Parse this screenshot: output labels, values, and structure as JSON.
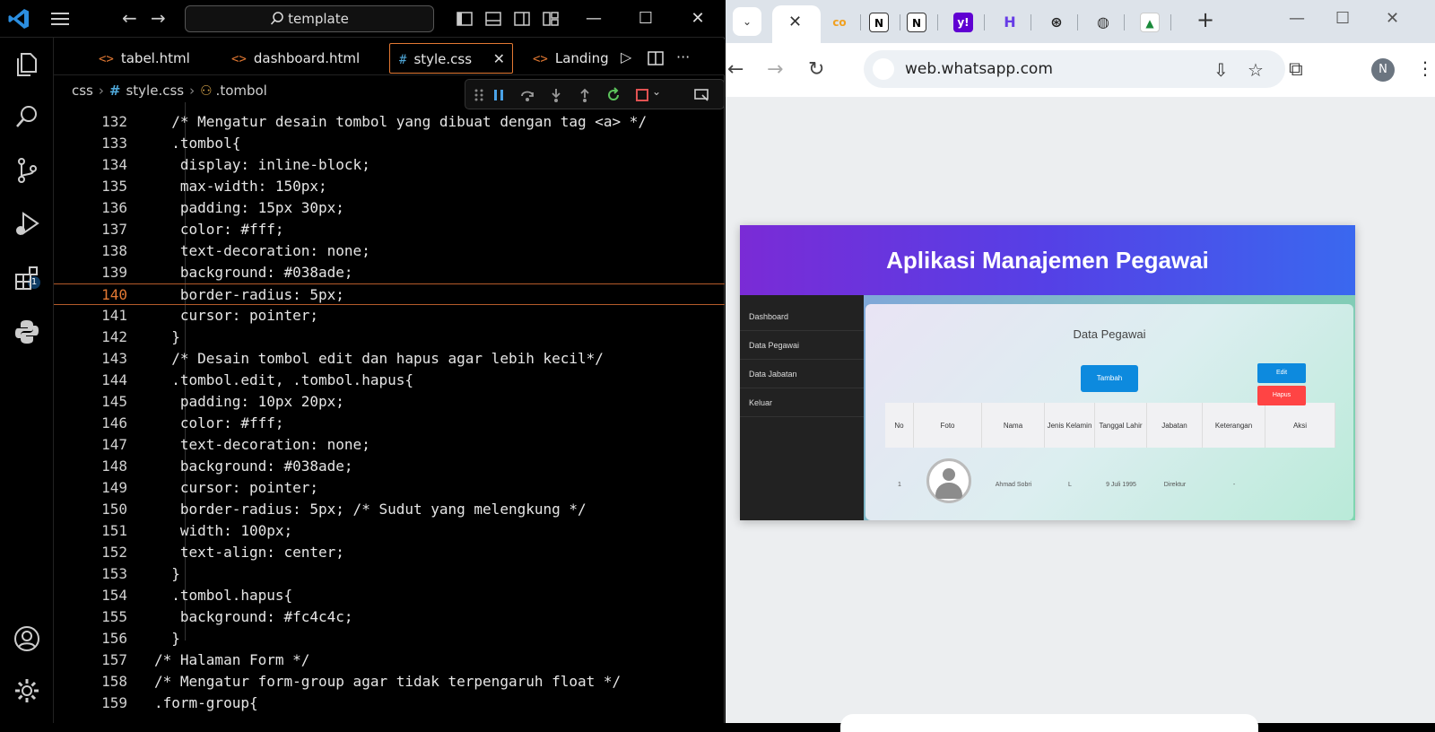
{
  "vscode": {
    "search": "template",
    "tabs": [
      {
        "label": "tabel.html",
        "icon": "<>"
      },
      {
        "label": "dashboard.html",
        "icon": "<>"
      },
      {
        "label": "style.css",
        "icon": "#"
      },
      {
        "label": "LandingP",
        "icon": "<>"
      }
    ],
    "breadcrumb": {
      "folder": "css",
      "file": "style.css",
      "symbol": ".tombol"
    },
    "debug_badge": "1",
    "current_line": "140",
    "lines": [
      {
        "n": "132",
        "code": "  /* Mengatur desain tombol yang dibuat dengan tag <a> */"
      },
      {
        "n": "133",
        "code": "  .tombol{"
      },
      {
        "n": "134",
        "code": "   display: inline-block;"
      },
      {
        "n": "135",
        "code": "   max-width: 150px;"
      },
      {
        "n": "136",
        "code": "   padding: 15px 30px;"
      },
      {
        "n": "137",
        "code": "   color: #fff;"
      },
      {
        "n": "138",
        "code": "   text-decoration: none;"
      },
      {
        "n": "139",
        "code": "   background: #038ade;"
      },
      {
        "n": "140",
        "code": "   border-radius: 5px;"
      },
      {
        "n": "141",
        "code": "   cursor: pointer;"
      },
      {
        "n": "142",
        "code": "  }"
      },
      {
        "n": "143",
        "code": "  /* Desain tombol edit dan hapus agar lebih kecil*/"
      },
      {
        "n": "144",
        "code": "  .tombol.edit, .tombol.hapus{"
      },
      {
        "n": "145",
        "code": "   padding: 10px 20px;"
      },
      {
        "n": "146",
        "code": "   color: #fff;"
      },
      {
        "n": "147",
        "code": "   text-decoration: none;"
      },
      {
        "n": "148",
        "code": "   background: #038ade;"
      },
      {
        "n": "149",
        "code": "   cursor: pointer;"
      },
      {
        "n": "150",
        "code": "   border-radius: 5px; /* Sudut yang melengkung */"
      },
      {
        "n": "151",
        "code": "   width: 100px;"
      },
      {
        "n": "152",
        "code": "   text-align: center;"
      },
      {
        "n": "153",
        "code": "  }"
      },
      {
        "n": "154",
        "code": "  .tombol.hapus{"
      },
      {
        "n": "155",
        "code": "   background: #fc4c4c;"
      },
      {
        "n": "156",
        "code": "  }"
      },
      {
        "n": "157",
        "code": "/* Halaman Form */"
      },
      {
        "n": "158",
        "code": "/* Mengatur form-group agar tidak terpengaruh float */"
      },
      {
        "n": "159",
        "code": ".form-group{"
      }
    ],
    "colors": {
      "accent": "#e37933",
      "css_icon": "#4fa7d8",
      "comment": "#6fb150",
      "swatch_white": "#ffffff",
      "swatch_blue": "#038ade",
      "swatch_red": "#fc4c4c"
    }
  },
  "browser": {
    "url": "web.whatsapp.com",
    "avatar_letter": "N",
    "favicons": [
      "co-icon",
      "notion-icon",
      "notion-icon",
      "yahoo-icon",
      "hostinger-icon",
      "chatgpt-icon",
      "globe-icon",
      "school-icon"
    ],
    "page": {
      "app_title": "Aplikasi Manajemen Pegawai",
      "sidebar": [
        "Dashboard",
        "Data Pegawai",
        "Data Jabatan",
        "Keluar"
      ],
      "card_title": "Data Pegawai",
      "add_button": "Tambah",
      "columns": [
        "No",
        "Foto",
        "Nama",
        "Jenis Kelamin",
        "Tanggal Lahir",
        "Jabatan",
        "Keterangan",
        "Aksi"
      ],
      "row": {
        "no": "1",
        "nama": "Ahmad Sobri",
        "jenis_kelamin": "L",
        "tanggal_lahir": "9 Juli 1995",
        "jabatan": "Direktur",
        "keterangan": "-"
      },
      "edit_label": "Edit",
      "hapus_label": "Hapus"
    }
  }
}
